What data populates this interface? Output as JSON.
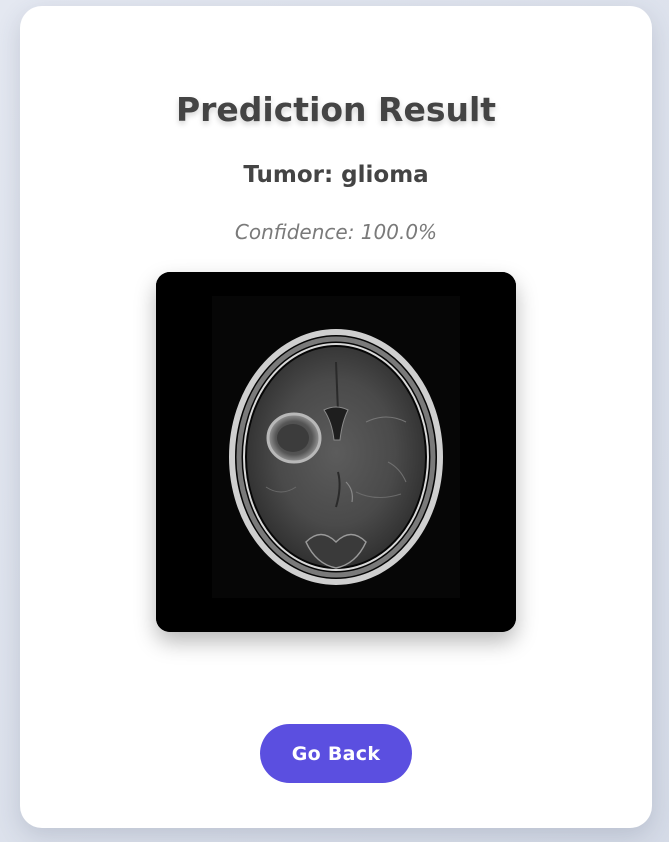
{
  "result": {
    "title": "Prediction Result",
    "tumor_text": "Tumor: glioma",
    "confidence_text": "Confidence: 100.0%"
  },
  "scan": {
    "image_name": "brain-mri-scan",
    "background_color": "#000000"
  },
  "actions": {
    "back_label": "Go Back",
    "back_color": "#5b4fe0"
  }
}
